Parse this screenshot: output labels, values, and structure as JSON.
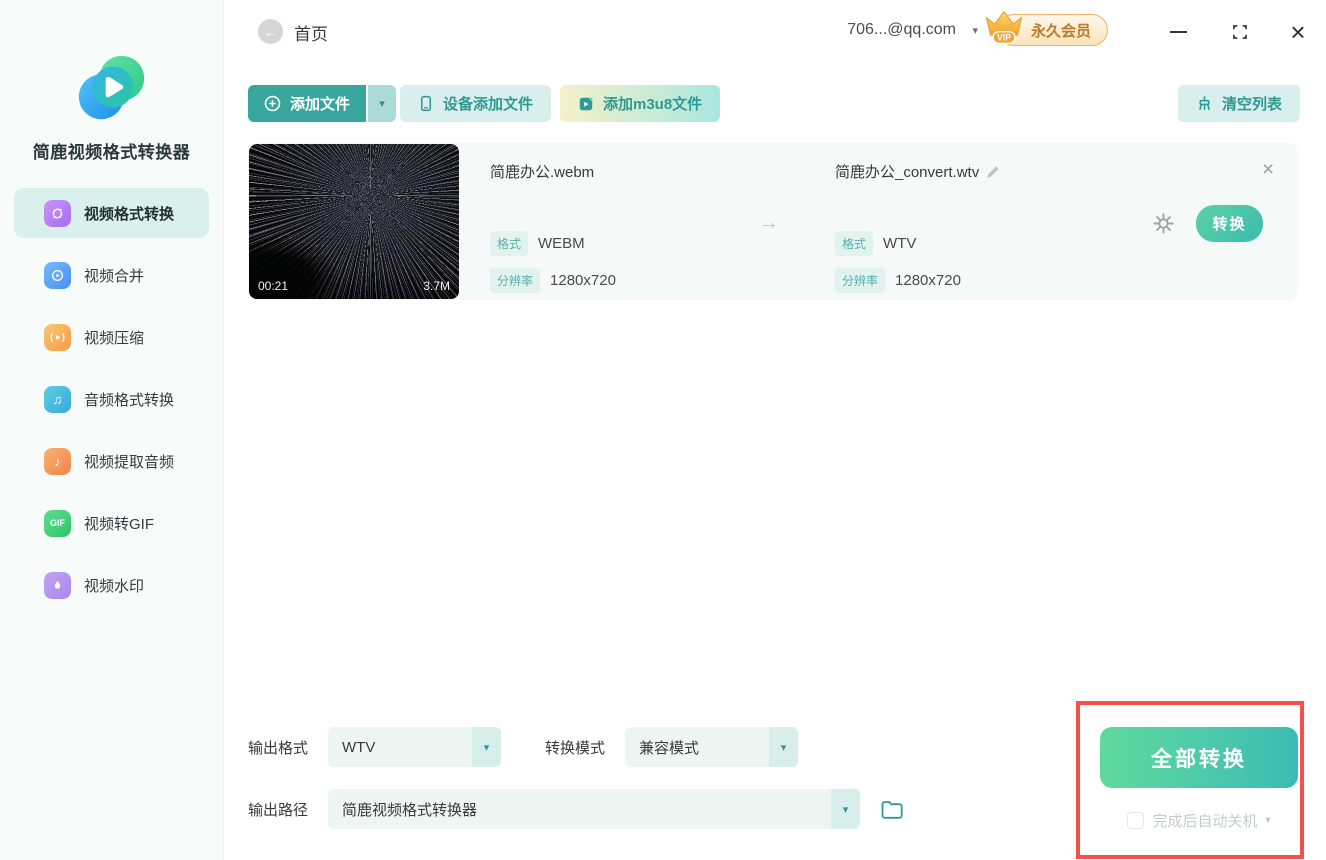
{
  "app_title": "简鹿视频格式转换器",
  "sidebar": {
    "items": [
      {
        "label": "视频格式转换",
        "active": true
      },
      {
        "label": "视频合并",
        "active": false
      },
      {
        "label": "视频压缩",
        "active": false
      },
      {
        "label": "音频格式转换",
        "active": false
      },
      {
        "label": "视频提取音频",
        "active": false
      },
      {
        "label": "视频转GIF",
        "active": false
      },
      {
        "label": "视频水印",
        "active": false
      }
    ]
  },
  "topbar": {
    "home": "首页",
    "account": "706...@qq.com",
    "vip": "永久会员"
  },
  "toolbar": {
    "add_file": "添加文件",
    "device_add": "设备添加文件",
    "add_m3u8": "添加m3u8文件",
    "clear_list": "清空列表"
  },
  "file_item": {
    "duration": "00:21",
    "size": "3.7M",
    "source": {
      "filename": "简鹿办公.webm",
      "format_label": "格式",
      "format": "WEBM",
      "resolution_label": "分辨率",
      "resolution": "1280x720"
    },
    "target": {
      "filename": "简鹿办公_convert.wtv",
      "format_label": "格式",
      "format": "WTV",
      "resolution_label": "分辨率",
      "resolution": "1280x720"
    },
    "convert_button": "转换"
  },
  "footer": {
    "output_format_label": "输出格式",
    "output_format_value": "WTV",
    "convert_mode_label": "转换模式",
    "convert_mode_value": "兼容模式",
    "output_path_label": "输出路径",
    "output_path_value": "简鹿视频格式转换器",
    "convert_all": "全部转换",
    "auto_shutdown": "完成后自动关机"
  },
  "icons": {
    "back": "←",
    "dropdown_caret": "▾",
    "arrow_right": "→",
    "close": "×",
    "music": "♫",
    "note": "♪",
    "gif": "GIF"
  },
  "colors": {
    "primary_teal": "#38a69d",
    "light_teal": "#d9efec",
    "accent_green_gradient": [
      "#5fda9d",
      "#3bbcb4"
    ],
    "vip_gold": "#f0a43c",
    "highlight_red": "#f4514c",
    "sidebar_bg": "#f7fbfa",
    "row_bg": "#f5faf9"
  }
}
